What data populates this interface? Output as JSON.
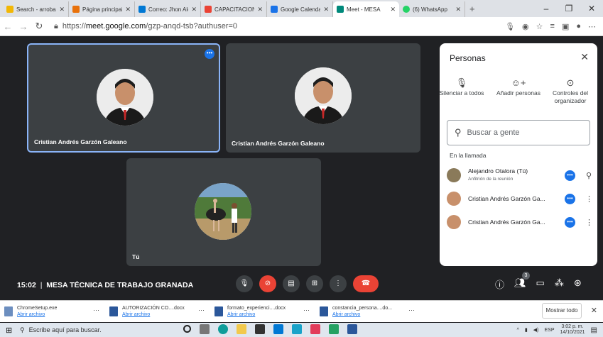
{
  "browser": {
    "tabs": [
      {
        "label": "Search - arroba",
        "color": "#f2b705"
      },
      {
        "label": "Página principal d",
        "color": "#e8710a"
      },
      {
        "label": "Correo: Jhon Alej",
        "color": "#0078d4"
      },
      {
        "label": "CAPACITACIONES",
        "color": "#ea4335"
      },
      {
        "label": "Google Calendar",
        "color": "#1a73e8"
      },
      {
        "label": "Meet - MESA",
        "color": "#00897b"
      },
      {
        "label": "(6) WhatsApp",
        "color": "#25d366"
      }
    ],
    "url_prefix": "https://",
    "url_host": "meet.google.com",
    "url_path": "/gzp-anqd-tsb?authuser=0"
  },
  "tiles": {
    "t1_name": "Cristian Andrés Garzón Galeano",
    "t2_name": "Cristian Andrés Garzón Galeano",
    "t3_name": "Tú"
  },
  "panel": {
    "title": "Personas",
    "actions": {
      "mute": "Silenciar a todos",
      "add": "Añadir personas",
      "host": "Controles del organizador"
    },
    "search_placeholder": "Buscar a gente",
    "in_call": "En la llamada",
    "people": [
      {
        "name": "Alejandro Otalora (Tú)",
        "sub": "Anfitrión de la reunión"
      },
      {
        "name": "Cristian Andrés Garzón Ga..."
      },
      {
        "name": "Cristian Andrés Garzón Ga..."
      }
    ]
  },
  "meeting": {
    "time": "15:02",
    "separator": "|",
    "title": "MESA TÉCNICA DE TRABAJO GRANADA",
    "participants_badge": "3"
  },
  "downloads": {
    "items": [
      {
        "file": "ChromeSetup.exe",
        "link": "Abrir archivo"
      },
      {
        "file": "AUTORIZACIÓN CO....docx",
        "link": "Abrir archivo"
      },
      {
        "file": "formato_experienci....docx",
        "link": "Abrir archivo"
      },
      {
        "file": "constancia_persona....do...",
        "link": "Abrir archivo"
      }
    ],
    "show_all": "Mostrar todo"
  },
  "taskbar": {
    "search_placeholder": "Escribe aquí para buscar.",
    "lang": "ESP",
    "time": "3:02 p. m.",
    "date": "14/10/2021"
  }
}
